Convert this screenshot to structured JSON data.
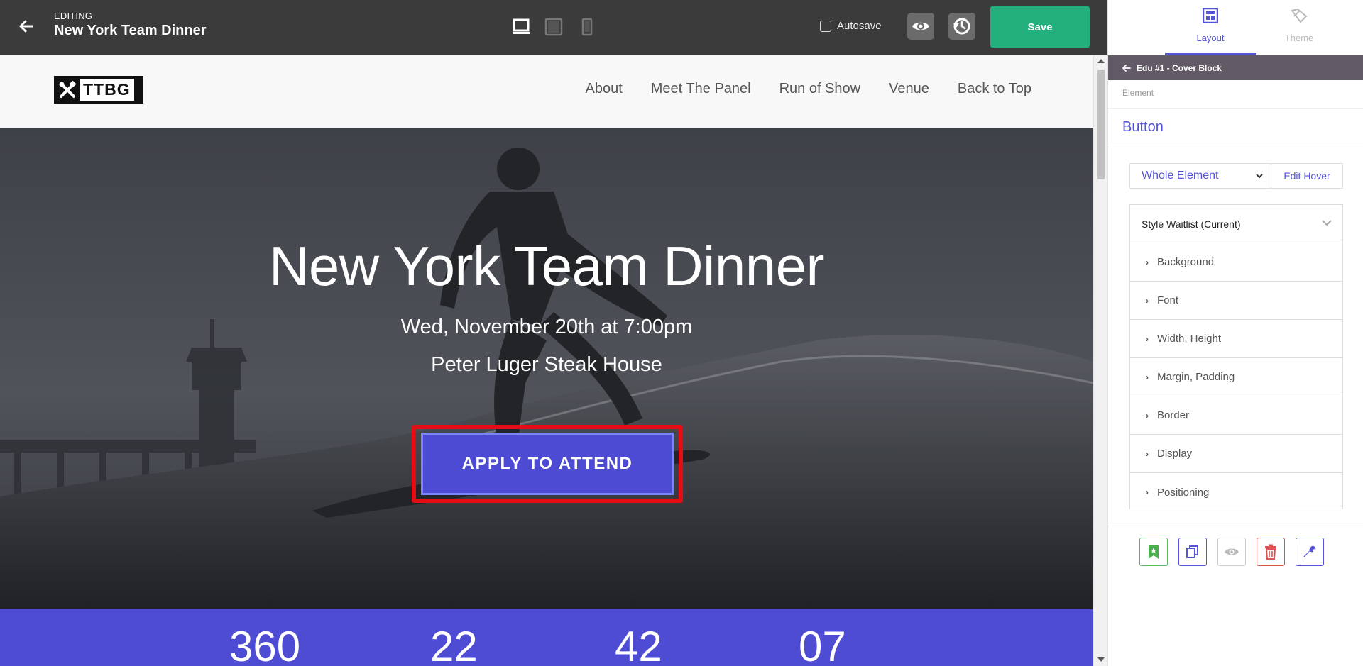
{
  "editor": {
    "editing_label": "EDITING",
    "doc_title": "New York Team Dinner",
    "autosave_label": "Autosave",
    "autosave_checked": false,
    "save_label": "Save",
    "devices": [
      "desktop-icon",
      "tablet-icon",
      "mobile-icon"
    ]
  },
  "site": {
    "logo_text": "TTBG",
    "nav": [
      "About",
      "Meet The Panel",
      "Run of Show",
      "Venue",
      "Back to Top"
    ],
    "hero": {
      "title": "New York Team Dinner",
      "date": "Wed, November 20th at 7:00pm",
      "venue": "Peter Luger Steak House",
      "cta": "APPLY TO ATTEND"
    },
    "stats": [
      "360",
      "22",
      "42",
      "07"
    ]
  },
  "panel": {
    "tabs": [
      {
        "label": "Layout",
        "icon": "layout-icon",
        "active": true
      },
      {
        "label": "Theme",
        "icon": "theme-icon",
        "active": false
      }
    ],
    "breadcrumb": "Edu #1 - Cover Block",
    "element_label": "Element",
    "element_name": "Button",
    "state_select": "Whole Element",
    "edit_hover": "Edit Hover",
    "style_title": "Style Waitlist (Current)",
    "properties": [
      "Background",
      "Font",
      "Width, Height",
      "Margin, Padding",
      "Border",
      "Display",
      "Positioning"
    ],
    "actions": [
      "bookmark-icon",
      "duplicate-icon",
      "visibility-icon",
      "delete-icon",
      "settings-wrench-icon"
    ]
  },
  "colors": {
    "accent": "#5553d7",
    "save_green": "#23b07d",
    "cta_button": "#4d4bd3",
    "highlight_red": "#e40d13",
    "topbar": "#3b3b3b",
    "breadcrumb_bar": "#625a66"
  }
}
